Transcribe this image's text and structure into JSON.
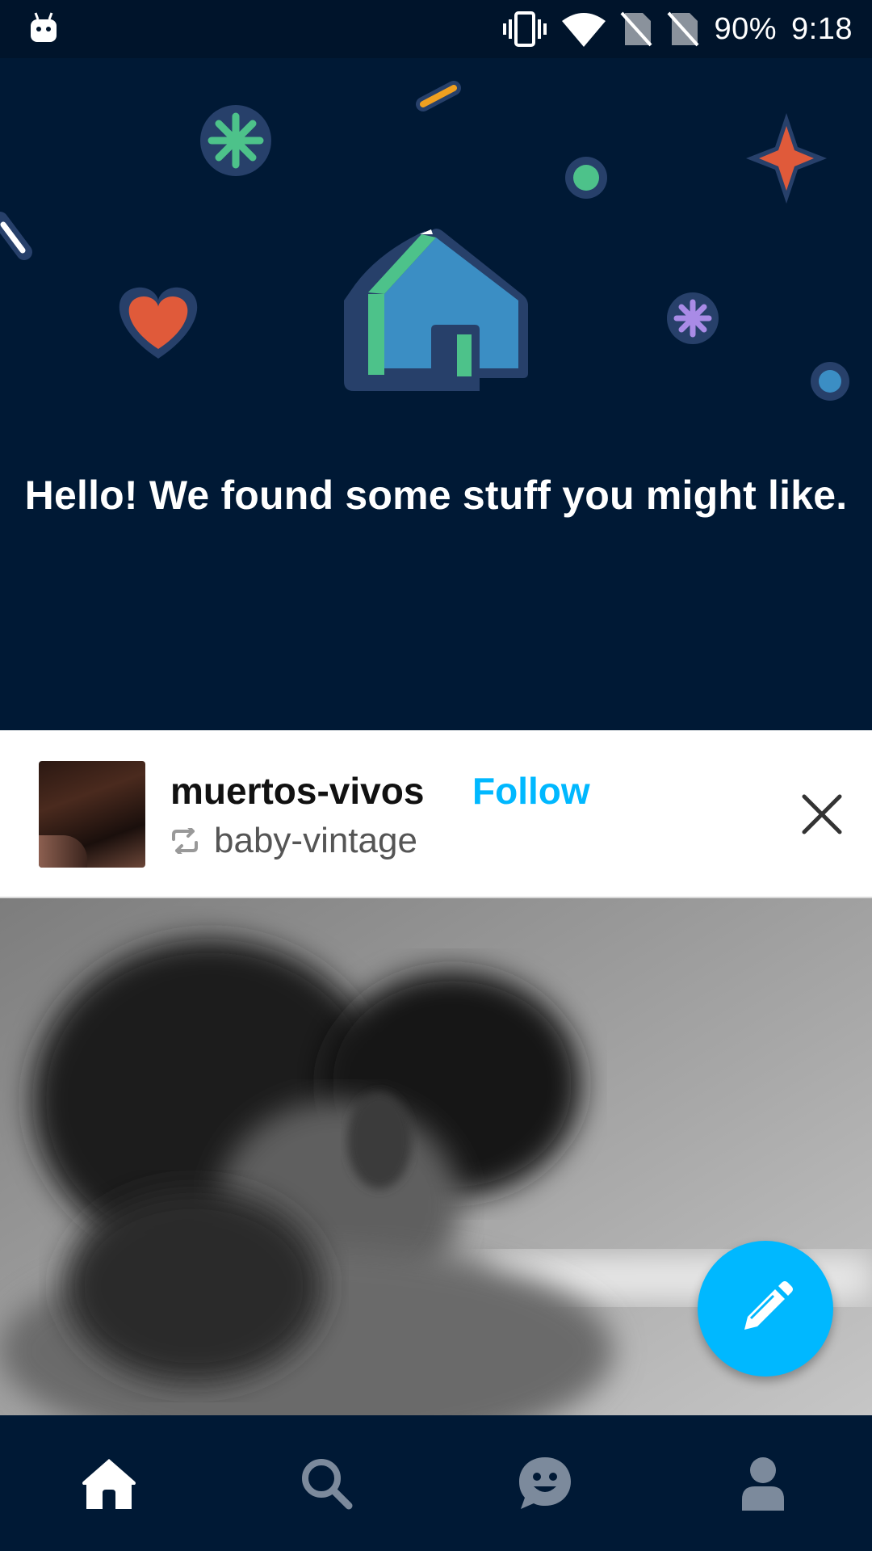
{
  "status_bar": {
    "battery": "90%",
    "time": "9:18",
    "icons": [
      "android-icon",
      "vibrate-icon",
      "wifi-icon",
      "no-sim-icon",
      "no-sim-icon",
      "battery-icon"
    ]
  },
  "hero": {
    "message": "Hello! We found some stuff you might like.",
    "illustration": "house-icon"
  },
  "post": {
    "blog_name": "muertos-vivos",
    "follow_label": "Follow",
    "reblogged_from": "baby-vintage",
    "reblog_icon": "reblog-icon",
    "close_icon": "close-icon"
  },
  "fab": {
    "icon": "pencil-icon"
  },
  "bottom_nav": {
    "items": [
      {
        "icon": "home-icon",
        "active": true
      },
      {
        "icon": "search-icon",
        "active": false
      },
      {
        "icon": "messaging-icon",
        "active": false
      },
      {
        "icon": "account-icon",
        "active": false
      }
    ]
  },
  "colors": {
    "background": "#001935",
    "accent": "#00b8ff",
    "nav_inactive": "#7c8a9c"
  }
}
